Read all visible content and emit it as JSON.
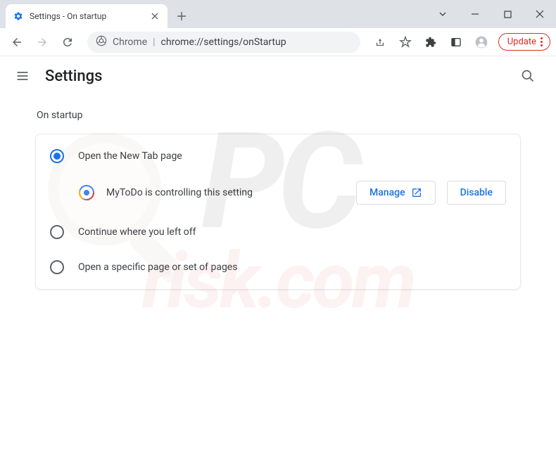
{
  "window": {
    "tab_title": "Settings - On startup"
  },
  "omnibox": {
    "scheme": "Chrome",
    "url": "chrome://settings/onStartup"
  },
  "toolbar": {
    "update_label": "Update"
  },
  "header": {
    "title": "Settings"
  },
  "section": {
    "title": "On startup",
    "options": [
      {
        "label": "Open the New Tab page",
        "selected": true
      },
      {
        "label": "Continue where you left off",
        "selected": false
      },
      {
        "label": "Open a specific page or set of pages",
        "selected": false
      }
    ],
    "extension_notice": {
      "text": "MyToDo is controlling this setting",
      "manage_label": "Manage",
      "disable_label": "Disable"
    }
  },
  "watermark": {
    "line1": "PC",
    "line2": "risk.com"
  }
}
